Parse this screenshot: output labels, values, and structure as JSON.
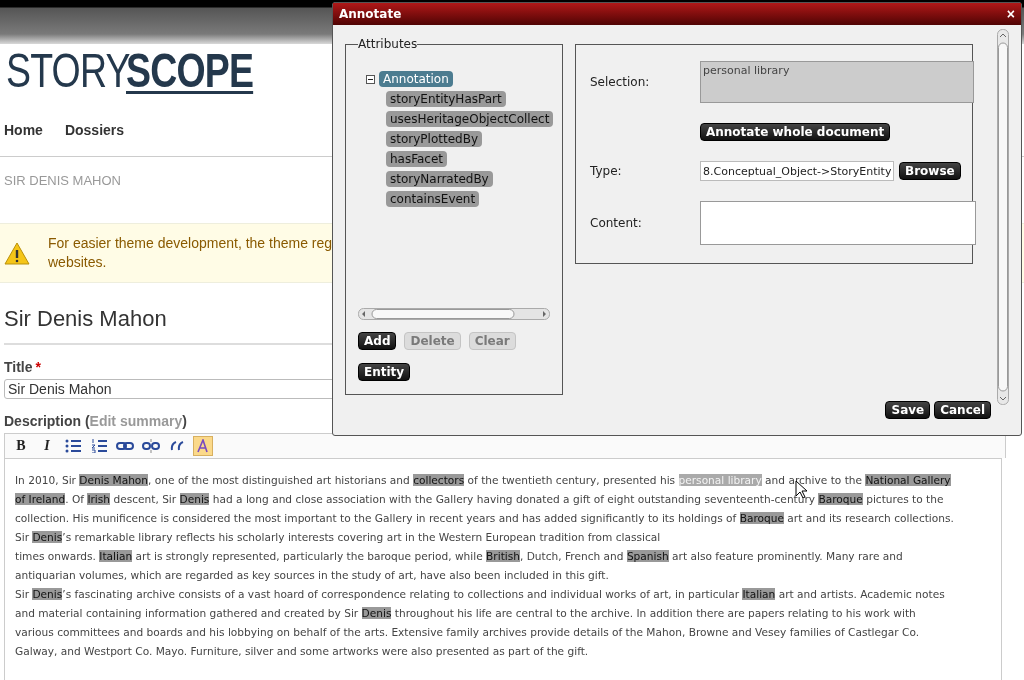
{
  "logo": {
    "light": "STORY",
    "bold": "SCOPE"
  },
  "nav": [
    {
      "label": "Home"
    },
    {
      "label": "Dossiers"
    }
  ],
  "breadcrumb": "SIR DENIS MAHON",
  "warning": {
    "lines": [
      "For easier theme development, the theme reg",
      "websites."
    ]
  },
  "page_title": "Sir Denis Mahon",
  "title_field": {
    "label": "Title",
    "required_mark": "*",
    "value": "Sir Denis Mahon"
  },
  "description": {
    "label": "Description (",
    "link": "Edit summary",
    "label_end": ")"
  },
  "toolbar": [
    {
      "kind": "bold",
      "label": "B",
      "active": false
    },
    {
      "kind": "italic",
      "label": "I",
      "active": false
    },
    {
      "kind": "bullets",
      "active": false
    },
    {
      "kind": "numbers",
      "active": false
    },
    {
      "kind": "link",
      "active": false
    },
    {
      "kind": "unlink",
      "active": false
    },
    {
      "kind": "quote",
      "active": false
    },
    {
      "kind": "annotate",
      "active": true
    }
  ],
  "editor_paragraphs": [
    [
      "In 2010, Sir **Denis Mahon**, one of the most distinguished art historians and **collectors** of the twentieth century, presented his *personal library* and archive to the **National Gallery**",
      "**of Ireland**. Of **Irish** descent, Sir **Denis** had a long and close association with the Gallery having donated a gift of eight outstanding seventeenth-century **Baroque** pictures to the",
      "collection. His munificence is considered the most important to the Gallery in recent years and has added significantly to its holdings of **Baroque** art and its research collections."
    ],
    [
      "Sir **Denis**’s remarkable library reflects his scholarly interests covering art in the Western European tradition from classical"
    ],
    [
      "times onwards. **Italian** art is strongly represented, particularly the baroque period, while **British**, Dutch, French and **Spanish** art also feature prominently. Many rare and",
      "antiquarian volumes, which are regarded as key sources in the study of art, have also been included in this gift."
    ],
    [
      "Sir **Denis**’s fascinating archive consists of a vast hoard of correspondence relating to collections and individual works of art, in particular **Italian** art and artists. Academic notes",
      "and material containing information gathered and created by Sir **Denis** throughout his life are central to the archive. In addition there are papers relating to his work with",
      "various committees and boards and his lobbying on behalf of the arts. Extensive family archives provide details of the Mahon, Browne and Vesey families of Castlegar Co.",
      "Galway, and Westport Co. Mayo. Furniture, silver and some artworks were also presented as part of the gift."
    ]
  ],
  "dialog": {
    "title": "Annotate",
    "close": "×",
    "attributes": {
      "legend": "Attributes",
      "tree": {
        "label": "Annotation",
        "expanded": true,
        "selected": true,
        "children": [
          {
            "label": "storyEntityHasPart",
            "selected": false
          },
          {
            "label": "usesHeritageObjectCollect",
            "selected": false
          },
          {
            "label": "storyPlottedBy",
            "selected": false
          },
          {
            "label": "hasFacet",
            "selected": false
          },
          {
            "label": "storyNarratedBy",
            "selected": false
          },
          {
            "label": "containsEvent",
            "selected": false
          }
        ]
      },
      "buttons": [
        {
          "label": "Add",
          "disabled": false
        },
        {
          "label": "Delete",
          "disabled": true
        },
        {
          "label": "Clear",
          "disabled": true
        }
      ],
      "entity_button": "Entity"
    },
    "selection": {
      "label": "Selection:",
      "value": "personal library"
    },
    "annotate_button": "Annotate whole document",
    "type": {
      "label": "Type:",
      "value": "8.Conceptual_Object->StoryEntity",
      "button": "Browse"
    },
    "content": {
      "label": "Content:"
    },
    "footer_buttons": [
      "Save",
      "Cancel"
    ]
  }
}
